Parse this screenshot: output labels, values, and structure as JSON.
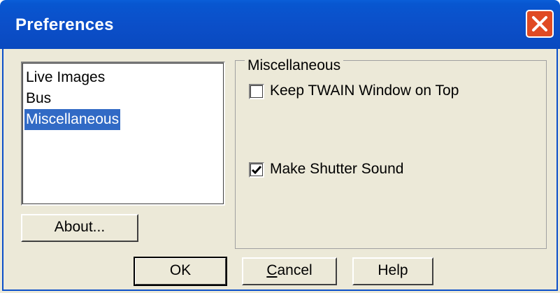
{
  "window": {
    "title": "Preferences"
  },
  "list": {
    "items": [
      {
        "label": "Live Images",
        "selected": false
      },
      {
        "label": "Bus",
        "selected": false
      },
      {
        "label": "Miscellaneous",
        "selected": true
      }
    ]
  },
  "buttons": {
    "about": "About...",
    "ok": "OK",
    "cancel": "Cancel",
    "help": "Help"
  },
  "group": {
    "label": "Miscellaneous",
    "options": [
      {
        "label": "Keep TWAIN Window on Top",
        "checked": false
      },
      {
        "label": "Make Shutter Sound",
        "checked": true
      }
    ]
  },
  "colors": {
    "titlebar": "#0b4fc9",
    "close_button": "#e04a22",
    "selection": "#316ac5",
    "face": "#ece9d8"
  },
  "icons": {
    "close": "close-icon",
    "check": "checkmark-icon"
  }
}
